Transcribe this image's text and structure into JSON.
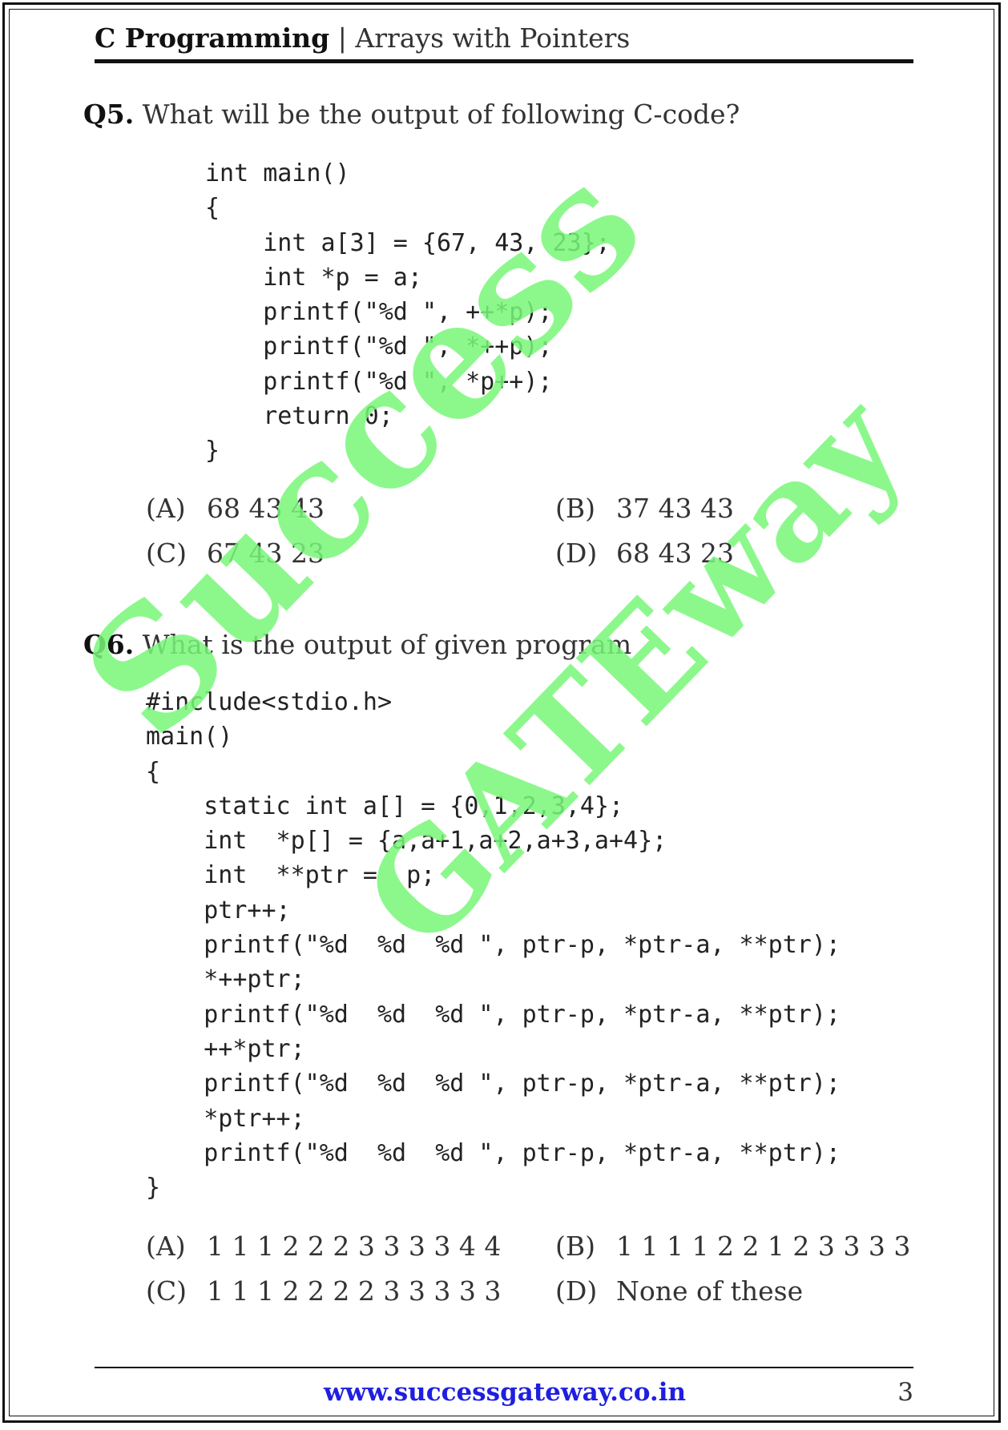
{
  "header": {
    "subject": "C Programming",
    "separator": "|",
    "topic": "Arrays with Pointers"
  },
  "watermark": {
    "line1": "Success",
    "line2": "GATEway",
    "color": "#79f779"
  },
  "questions": [
    {
      "number": "Q5.",
      "text": "What will be the output of following C-code?",
      "code": "int main()\n{\n    int a[3] = {67, 43, 23};\n    int *p = a;\n    printf(\"%d \", ++*p);\n    printf(\"%d \", *++p);\n    printf(\"%d \", *p++);\n    return 0;\n}",
      "options": [
        {
          "label": "(A)",
          "text": "68 43 43"
        },
        {
          "label": "(B)",
          "text": "37 43 43"
        },
        {
          "label": "(C)",
          "text": "67 43 23"
        },
        {
          "label": "(D)",
          "text": "68 43 23"
        }
      ]
    },
    {
      "number": "Q6.",
      "text": "What is the output of given program",
      "code": "#include<stdio.h>\nmain()\n{\n    static int a[] = {0,1,2,3,4};\n    int  *p[] = {a,a+1,a+2,a+3,a+4};\n    int  **ptr =  p;\n    ptr++;\n    printf(\"%d  %d  %d \", ptr-p, *ptr-a, **ptr);\n    *++ptr;\n    printf(\"%d  %d  %d \", ptr-p, *ptr-a, **ptr);\n    ++*ptr;\n    printf(\"%d  %d  %d \", ptr-p, *ptr-a, **ptr);\n    *ptr++;\n    printf(\"%d  %d  %d \", ptr-p, *ptr-a, **ptr);\n}",
      "options": [
        {
          "label": "(A)",
          "text": "1 1 1 2 2 2 3 3 3 3 4 4"
        },
        {
          "label": "(B)",
          "text": "1 1 1 1 2 2 1 2 3 3 3 3"
        },
        {
          "label": "(C)",
          "text": "1 1 1 2 2 2 2 3 3 3 3 3"
        },
        {
          "label": "(D)",
          "text": "None of these"
        }
      ]
    }
  ],
  "footer": {
    "website": "www.successgateway.co.in",
    "page_number": "3",
    "link_color": "#1f1fe0"
  }
}
